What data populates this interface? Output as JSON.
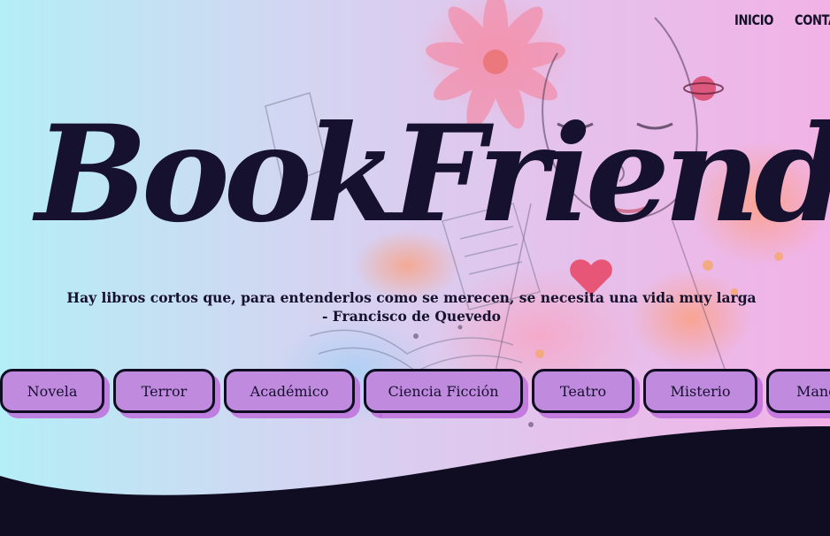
{
  "nav": {
    "items": [
      "INICIO",
      "CONTA"
    ]
  },
  "brand": {
    "title": "BookFriend"
  },
  "quote": {
    "line1": "Hay libros cortos que, para entenderlos como se merecen, se necesita una vida muy larga",
    "line2": "- Francisco de Quevedo"
  },
  "genres": [
    "Novela",
    "Terror",
    "Académico",
    "Ciencia Ficción",
    "Teatro",
    "Misterio",
    "Mang"
  ],
  "colors": {
    "dark": "#100c22",
    "pill_fill": "#c08adf",
    "gradient_left": "#b4eef6",
    "gradient_right": "#f2b2e6"
  }
}
